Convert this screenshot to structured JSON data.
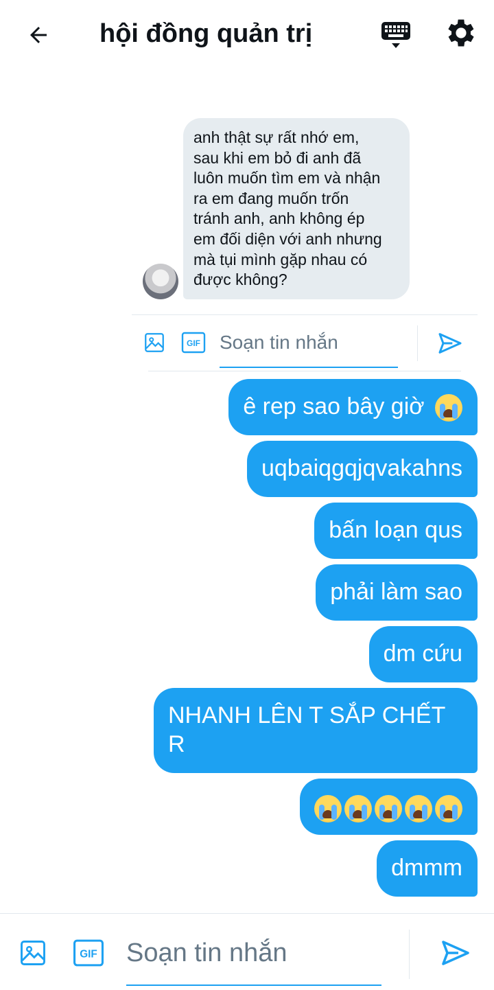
{
  "header": {
    "title": "hội đồng quản trị",
    "back_icon": "arrow-left-icon",
    "keyboard_icon": "keyboard-icon",
    "settings_icon": "gear-icon"
  },
  "received_message": {
    "text": "anh thật sự rất nhớ em, sau khi em bỏ đi anh đã luôn muốn tìm em và nhận ra em đang muốn trốn tránh anh, anh không ép em đối diện với anh nhưng mà tụi mình gặp nhau có được không?",
    "lines": [
      "anh thật sự rất nhớ em,",
      "sau khi em bỏ đi anh đã",
      "luôn muốn tìm em và nhận",
      "ra em đang muốn trốn",
      "tránh anh, anh không ép",
      "em đối diện với anh nhưng",
      "mà tụi mình gặp nhau có",
      "được không?"
    ]
  },
  "inline_composer": {
    "placeholder": "Soạn tin nhắn"
  },
  "sent_messages": [
    {
      "text": "ê rep sao bây giờ",
      "emoji": "😭"
    },
    {
      "text": "uqbaiqgqjqvakahns"
    },
    {
      "text": "bấn loạn qus"
    },
    {
      "text": "phải làm sao"
    },
    {
      "text": "dm cứu"
    },
    {
      "text": "NHANH LÊN T SẮP CHẾT",
      "text_line2": "R"
    },
    {
      "emoji_row": "😭😭😭😭😭"
    },
    {
      "text": "dmmm"
    }
  ],
  "bottom_composer": {
    "placeholder": "Soạn tin nhắn"
  },
  "colors": {
    "accent": "#1da1f2",
    "received_bg": "#e6ecf0",
    "text": "#0f1419",
    "placeholder": "#657786"
  }
}
